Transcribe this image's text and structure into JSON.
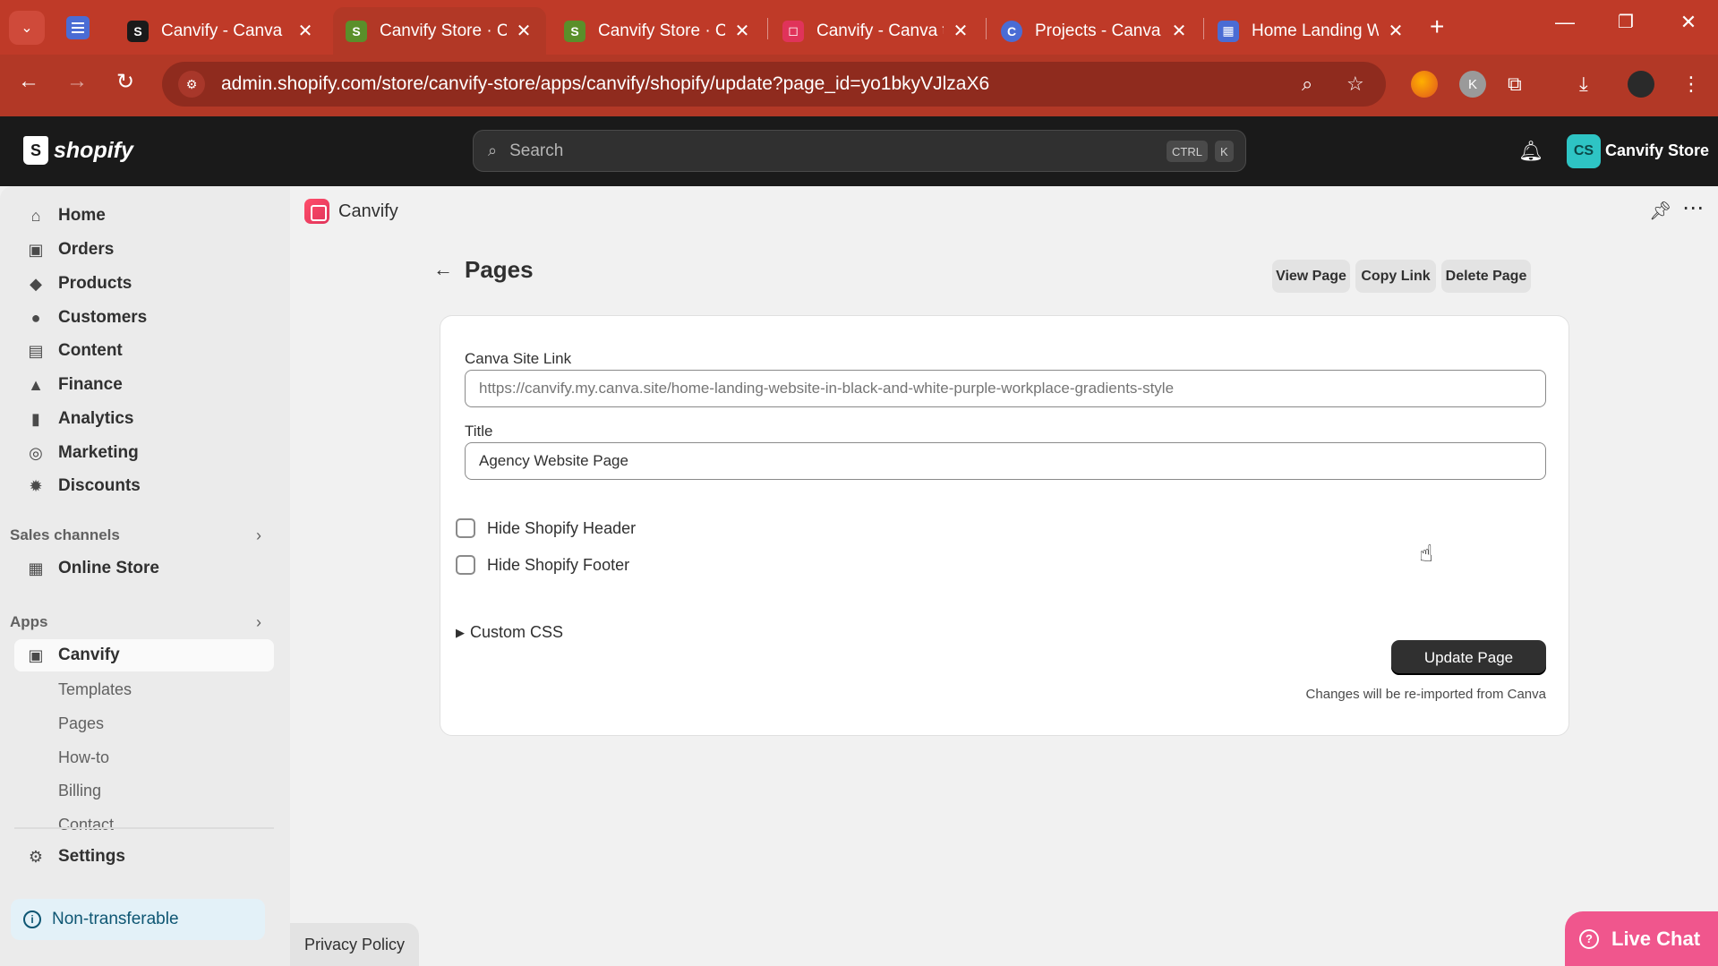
{
  "browser": {
    "tabs": [
      {
        "label": "Canvify - Canva P",
        "favicon": "shopify-icon",
        "color": "#1a1a1a",
        "active": false
      },
      {
        "label": "Canvify Store · Ca",
        "favicon": "shopify-icon",
        "color": "#5a8f2a",
        "active": true
      },
      {
        "label": "Canvify Store · Cu",
        "favicon": "shopify-icon",
        "color": "#5a8f2a",
        "active": false
      },
      {
        "label": "Canvify - Canva t",
        "favicon": "canvify-icon",
        "color": "#e0335a",
        "active": false
      },
      {
        "label": "Projects - Canva",
        "favicon": "canva-icon",
        "color": "#4a6cd4",
        "active": false
      },
      {
        "label": "Home Landing W",
        "favicon": "calendar-icon",
        "color": "#4a6cd4",
        "active": false
      }
    ],
    "url": "admin.shopify.com/store/canvify-store/apps/canvify/shopify/update?page_id=yo1bkyVJlzaX6"
  },
  "topbar": {
    "logo": "shopify",
    "search_placeholder": "Search",
    "kbd_ctrl": "CTRL",
    "kbd_k": "K",
    "store_initials": "CS",
    "store_name": "Canvify Store"
  },
  "sidebar": {
    "items": [
      {
        "label": "Home",
        "icon": "home-icon"
      },
      {
        "label": "Orders",
        "icon": "inbox-icon"
      },
      {
        "label": "Products",
        "icon": "tag-icon"
      },
      {
        "label": "Customers",
        "icon": "person-icon"
      },
      {
        "label": "Content",
        "icon": "image-icon"
      },
      {
        "label": "Finance",
        "icon": "bank-icon"
      },
      {
        "label": "Analytics",
        "icon": "bar-chart-icon"
      },
      {
        "label": "Marketing",
        "icon": "target-icon"
      },
      {
        "label": "Discounts",
        "icon": "discount-icon"
      }
    ],
    "sales_channels_label": "Sales channels",
    "online_store_label": "Online Store",
    "apps_label": "Apps",
    "canvify_label": "Canvify",
    "sub_items": [
      "Templates",
      "Pages",
      "How-to",
      "Billing",
      "Contact"
    ],
    "settings_label": "Settings",
    "nontransferable_label": "Non-transferable"
  },
  "app": {
    "name": "Canvify",
    "page_title": "Pages",
    "buttons": {
      "view_page": "View Page",
      "copy_link": "Copy Link",
      "delete_page": "Delete Page"
    },
    "form": {
      "site_link_label": "Canva Site Link",
      "site_link_placeholder": "https://canvify.my.canva.site/home-landing-website-in-black-and-white-purple-workplace-gradients-style",
      "title_label": "Title",
      "title_value": "Agency Website Page",
      "hide_header_label": "Hide Shopify Header",
      "hide_footer_label": "Hide Shopify Footer",
      "custom_css_label": "Custom CSS",
      "update_button": "Update Page",
      "hint": "Changes will be re-imported from Canva"
    },
    "privacy_policy": "Privacy Policy",
    "live_chat": "Live Chat"
  }
}
